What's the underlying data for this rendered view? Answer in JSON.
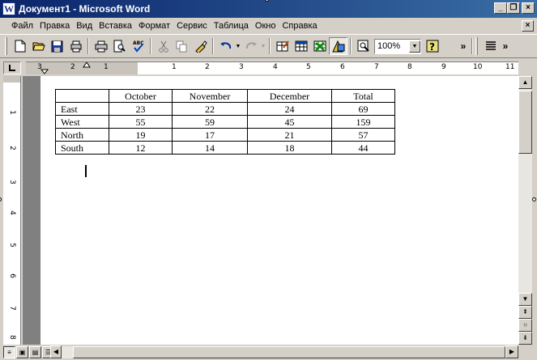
{
  "window": {
    "title": "Документ1 - Microsoft Word",
    "icon": "word-document-icon",
    "title_bar_color": "#0a246a"
  },
  "menu": {
    "items": [
      "Файл",
      "Правка",
      "Вид",
      "Вставка",
      "Формат",
      "Сервис",
      "Таблица",
      "Окно",
      "Справка"
    ]
  },
  "toolbar": {
    "zoom": "100%"
  },
  "ruler": {
    "horizontal_labels": [
      "3",
      "2",
      "1",
      "1",
      "2",
      "3",
      "4",
      "5",
      "6",
      "7",
      "8",
      "9",
      "10",
      "11"
    ],
    "vertical_labels": [
      "1",
      "1",
      "2",
      "3",
      "4",
      "5",
      "6",
      "7",
      "8"
    ]
  },
  "table": {
    "headers": [
      "",
      "October",
      "November",
      "December",
      "Total"
    ],
    "rows": [
      [
        "East",
        "23",
        "22",
        "24",
        "69"
      ],
      [
        "West",
        "55",
        "59",
        "45",
        "159"
      ],
      [
        "North",
        "19",
        "17",
        "21",
        "57"
      ],
      [
        "South",
        "12",
        "14",
        "18",
        "44"
      ]
    ]
  }
}
